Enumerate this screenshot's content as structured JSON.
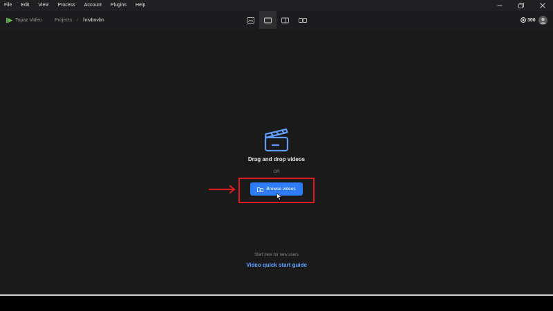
{
  "menubar": {
    "items": [
      "File",
      "Edit",
      "View",
      "Process",
      "Account",
      "Plugins",
      "Help"
    ]
  },
  "window_controls": [
    "minimize-icon",
    "restore-icon",
    "close-icon"
  ],
  "toolbar": {
    "brand": "Topaz Video",
    "breadcrumb": {
      "root": "Projects",
      "separator": "/",
      "current": "hnvbnvbn"
    },
    "view_modes": [
      "single-preview-icon",
      "full-frame-icon",
      "split-view-icon",
      "side-by-side-icon"
    ],
    "active_view": 1,
    "credits": "300"
  },
  "main": {
    "drop_title": "Drag and drop videos",
    "or": "OR",
    "browse_label": "Browse videos",
    "start_hint": "Start here for new users",
    "guide_link": "Video quick start guide"
  },
  "colors": {
    "accent": "#2f7df6",
    "link": "#5aa0ff",
    "highlight": "#e11b1f",
    "brand": "#5cc43d"
  }
}
